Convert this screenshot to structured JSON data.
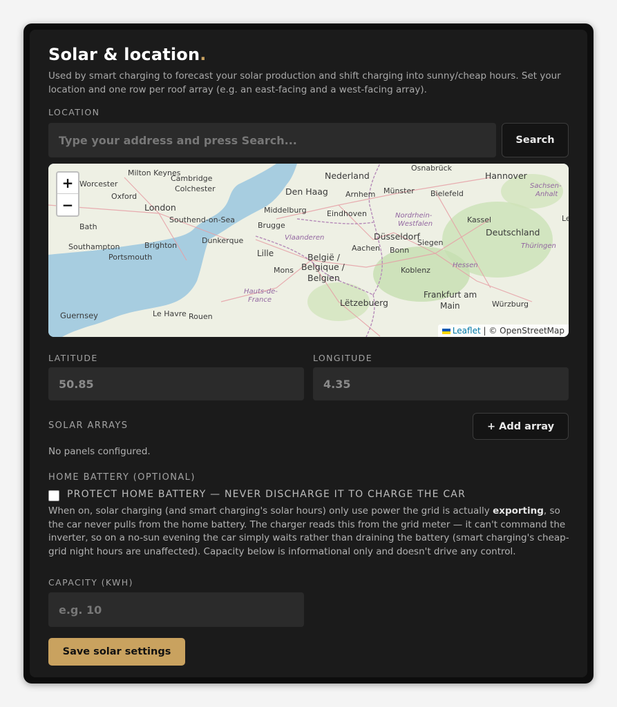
{
  "header": {
    "title": "Solar & location",
    "title_dot": ".",
    "description": "Used by smart charging to forecast your solar production and shift charging into sunny/cheap hours. Set your location and one row per roof array (e.g. an east-facing and a west-facing array)."
  },
  "location": {
    "label": "LOCATION",
    "search_placeholder": "Type your address and press Search...",
    "search_button": "Search"
  },
  "map": {
    "zoom_in": "+",
    "zoom_out": "−",
    "attribution_link": "Leaflet",
    "attribution_sep": " | © OpenStreetMap",
    "cities": {
      "milton_keynes": "Milton Keynes",
      "cambridge": "Cambridge",
      "colchester": "Colchester",
      "oxford": "Oxford",
      "london": "London",
      "southend": "Southend-on-Sea",
      "bath": "Bath",
      "southampton": "Southampton",
      "brighton": "Brighton",
      "portsmouth": "Portsmouth",
      "guernsey": "Guernsey",
      "le_havre": "Le Havre",
      "rouen": "Rouen",
      "dunkerque": "Dunkerque",
      "lille": "Lille",
      "mons": "Mons",
      "brugge": "Brugge",
      "middelburg": "Middelburg",
      "den_haag": "Den Haag",
      "nederland": "Nederland",
      "arnhem": "Arnhem",
      "eindhoven": "Eindhoven",
      "munster": "Münster",
      "osnabruck": "Osnabrück",
      "bielefeld": "Bielefeld",
      "hannover": "Hannover",
      "kassel": "Kassel",
      "dusseldorf": "Düsseldorf",
      "aachen": "Aachen",
      "bonn": "Bonn",
      "siegen": "Siegen",
      "koblenz": "Koblenz",
      "belgie": "België /",
      "belgique": "Belgique /",
      "belgien": "Belgien",
      "letzebuerg": "Lëtzebuerg",
      "deutschland": "Deutschland",
      "frankfurt": "Frankfurt am",
      "main": "Main",
      "wurzburg": "Würzburg",
      "vlaanderen": "Vlaanderen",
      "nordrhein": "Nordrhein-",
      "westfalen": "Westfalen",
      "hessen": "Hessen",
      "thuringen": "Thüringen",
      "sachsen": "Sachsen-",
      "anhalt": "Anhalt",
      "hauts": "Hauts-de-",
      "france": "France",
      "worcester": "Worcester",
      "le": "Le"
    }
  },
  "coords": {
    "latitude_label": "LATITUDE",
    "latitude_value": "50.85",
    "longitude_label": "LONGITUDE",
    "longitude_value": "4.35"
  },
  "arrays": {
    "label": "SOLAR ARRAYS",
    "add_button": "+ Add array",
    "empty_text": "No panels configured."
  },
  "battery": {
    "label": "HOME BATTERY (OPTIONAL)",
    "protect_label": "PROTECT HOME BATTERY — NEVER DISCHARGE IT TO CHARGE THE CAR",
    "text_before": "When on, solar charging (and smart charging's solar hours) only use power the grid is actually ",
    "text_bold": "exporting",
    "text_after": ", so the car never pulls from the home battery. The charger reads this from the grid meter — it can't command the inverter, so on a no-sun evening the car simply waits rather than draining the battery (smart charging's cheap-grid night hours are unaffected). Capacity below is informational only and doesn't drive any control.",
    "capacity_label": "CAPACITY (KWH)",
    "capacity_placeholder": "e.g. 10"
  },
  "footer": {
    "save_button": "Save solar settings"
  },
  "colors": {
    "accent": "#c9a25f",
    "panel": "#1b1b1b",
    "input": "#2b2b2b",
    "sea": "#a7cde0",
    "land": "#eef0e4",
    "forest": "#c6dfb0"
  }
}
